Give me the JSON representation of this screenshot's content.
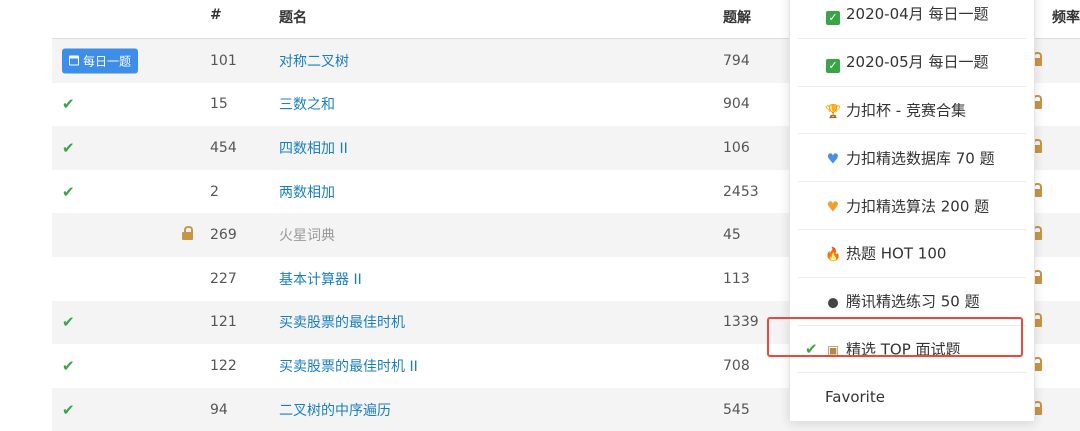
{
  "header": {
    "num": "#",
    "title": "题名",
    "solutions": "题解",
    "frequency": "频率",
    "help": "?"
  },
  "rows": [
    {
      "status": "daily",
      "badge": "每日一题",
      "locked": false,
      "num": "101",
      "title": "对称二叉树",
      "solutions": "794"
    },
    {
      "status": "solved",
      "locked": false,
      "num": "15",
      "title": "三数之和",
      "solutions": "904"
    },
    {
      "status": "solved",
      "locked": false,
      "num": "454",
      "title": "四数相加 II",
      "solutions": "106"
    },
    {
      "status": "solved",
      "locked": false,
      "num": "2",
      "title": "两数相加",
      "solutions": "2453"
    },
    {
      "status": "none",
      "locked": true,
      "num": "269",
      "title": "火星词典",
      "solutions": "45"
    },
    {
      "status": "none",
      "locked": false,
      "num": "227",
      "title": "基本计算器 II",
      "solutions": "113"
    },
    {
      "status": "solved",
      "locked": false,
      "num": "121",
      "title": "买卖股票的最佳时机",
      "solutions": "1339"
    },
    {
      "status": "solved",
      "locked": false,
      "num": "122",
      "title": "买卖股票的最佳时机 II",
      "solutions": "708"
    },
    {
      "status": "solved",
      "locked": false,
      "num": "94",
      "title": "二叉树的中序遍历",
      "solutions": "545"
    }
  ],
  "dropdown": {
    "items": [
      {
        "icon": "check-box",
        "label": "2020-04月 每日一题",
        "selected": false
      },
      {
        "icon": "check-box",
        "label": "2020-05月 每日一题",
        "selected": false
      },
      {
        "icon": "trophy",
        "label": "力扣杯 - 竞赛合集",
        "selected": false
      },
      {
        "icon": "blue-heart",
        "label": "力扣精选数据库 70 题",
        "selected": false
      },
      {
        "icon": "orange-heart",
        "label": "力扣精选算法 200 题",
        "selected": false
      },
      {
        "icon": "fire",
        "label": "热题 HOT 100",
        "selected": false
      },
      {
        "icon": "penguin",
        "label": "腾讯精选练习 50 题",
        "selected": false
      },
      {
        "icon": "computer",
        "label": "精选 TOP 面试题",
        "selected": true
      },
      {
        "icon": "none",
        "label": "Favorite",
        "selected": false
      }
    ]
  },
  "colors": {
    "link": "#1a7fc1",
    "check": "#3aa547",
    "lock": "#c89545",
    "badge": "#3d8ee8",
    "highlight": "#e84b3c"
  }
}
